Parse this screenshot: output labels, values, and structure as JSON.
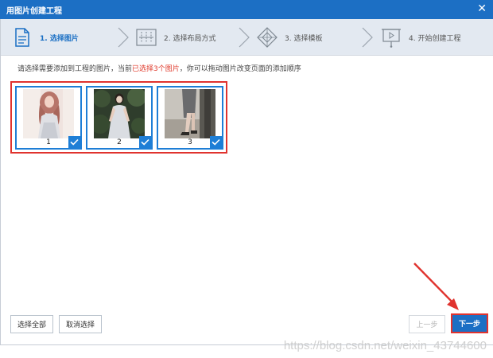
{
  "window": {
    "title": "用图片创建工程",
    "close_glyph": "✕"
  },
  "steps": [
    {
      "label": "1. 选择图片",
      "icon": "document-image-icon",
      "active": true
    },
    {
      "label": "2. 选择布局方式",
      "icon": "layout-grid-icon",
      "active": false
    },
    {
      "label": "3. 选择模板",
      "icon": "template-diamond-icon",
      "active": false
    },
    {
      "label": "4. 开始创建工程",
      "icon": "presentation-board-icon",
      "active": false
    }
  ],
  "instruction": {
    "prefix": "请选择需要添加到工程的图片，当前",
    "highlight": "已选择3个图片",
    "suffix": "，你可以拖动图片改变页面的添加顺序"
  },
  "images": [
    {
      "number": "1",
      "checked": true
    },
    {
      "number": "2",
      "checked": true
    },
    {
      "number": "3",
      "checked": true
    }
  ],
  "buttons": {
    "select_all": "选择全部",
    "cancel_select": "取消选择",
    "prev": "上一步",
    "next": "下一步"
  },
  "watermark": "https://blog.csdn.net/weixin_43744600",
  "colors": {
    "titlebar": "#1c6fc4",
    "accent": "#1e7ed6",
    "highlight_red": "#e0332e"
  }
}
